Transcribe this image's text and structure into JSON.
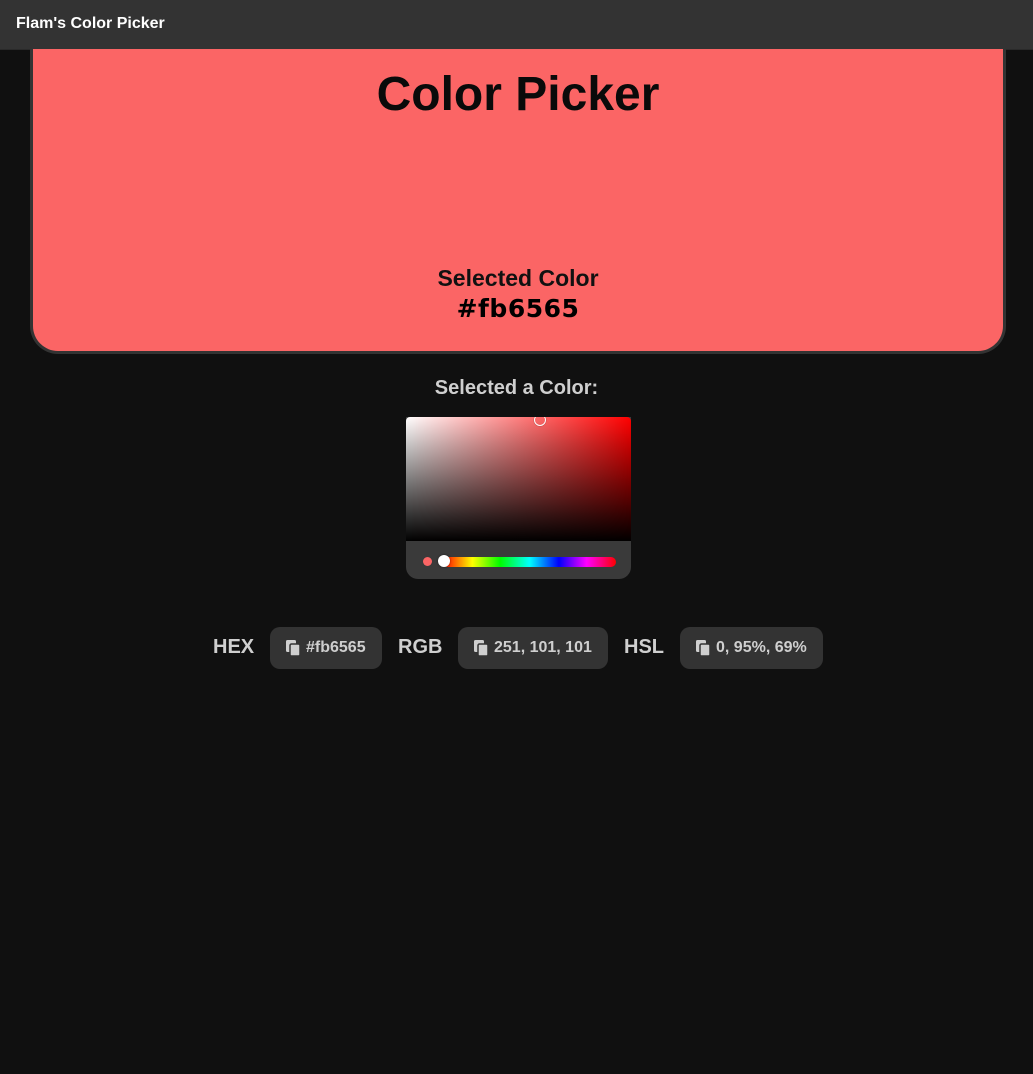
{
  "app": {
    "title": "Flam's Color Picker"
  },
  "preview": {
    "title": "Color Picker",
    "selected_label": "Selected Color",
    "selected_hex": "#fb6565",
    "background_color": "#fb6565"
  },
  "picker": {
    "heading": "Selected a Color:",
    "base_hue_color": "#ff0000",
    "current_color": "#fb6565",
    "hue_degrees": 0,
    "saturation_percent": 60,
    "value_percent": 98
  },
  "values": [
    {
      "label": "HEX",
      "value": "#fb6565",
      "icon": "copy-icon"
    },
    {
      "label": "RGB",
      "value": "251, 101, 101",
      "icon": "copy-icon"
    },
    {
      "label": "HSL",
      "value": "0, 95%, 69%",
      "icon": "copy-icon"
    }
  ]
}
